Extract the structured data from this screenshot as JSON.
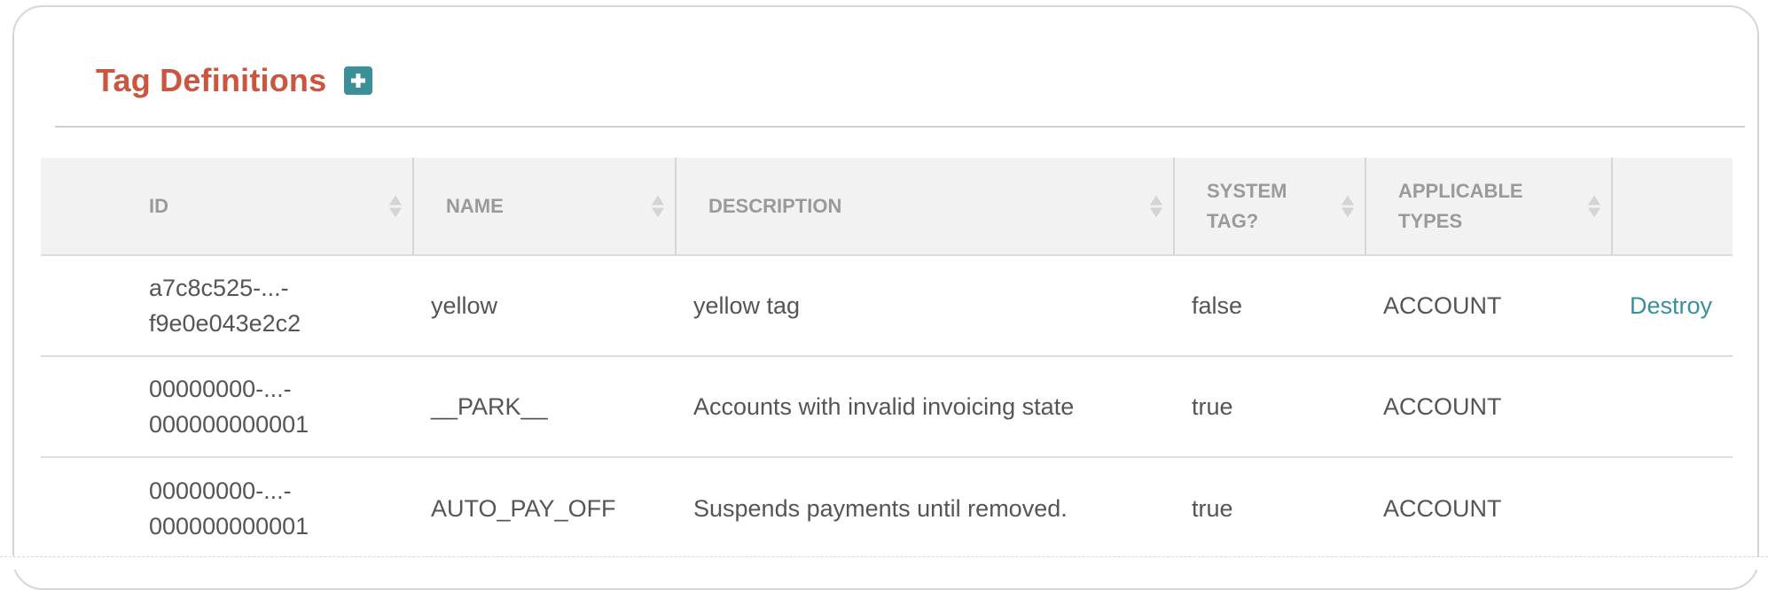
{
  "page": {
    "title": "Tag Definitions",
    "add_icon": "plus-icon"
  },
  "colors": {
    "title": "#cc5540",
    "accent": "#3a8f98",
    "header_bg": "#f2f2f2",
    "header_text": "#9a9a9a",
    "cell_text": "#555555"
  },
  "table": {
    "columns": [
      {
        "label": "ID",
        "sortable": true
      },
      {
        "label": "NAME",
        "sortable": true
      },
      {
        "label": "DESCRIPTION",
        "sortable": true
      },
      {
        "label_line1": "SYSTEM",
        "label_line2": "TAG?",
        "sortable": true
      },
      {
        "label_line1": "APPLICABLE",
        "label_line2": "TYPES",
        "sortable": true
      },
      {
        "label": "",
        "sortable": false
      }
    ],
    "rows": [
      {
        "id_line1": "a7c8c525-...-",
        "id_line2": "f9e0e043e2c2",
        "name": "yellow",
        "description": "yellow tag",
        "system_tag": "false",
        "applicable_types": "ACCOUNT",
        "action": "Destroy"
      },
      {
        "id_line1": "00000000-...-",
        "id_line2": "000000000001",
        "name": "__PARK__",
        "description": "Accounts with invalid invoicing state",
        "system_tag": "true",
        "applicable_types": "ACCOUNT",
        "action": ""
      },
      {
        "id_line1": "00000000-...-",
        "id_line2": "000000000001",
        "name": "AUTO_PAY_OFF",
        "description": "Suspends payments until removed.",
        "system_tag": "true",
        "applicable_types": "ACCOUNT",
        "action": ""
      }
    ]
  }
}
